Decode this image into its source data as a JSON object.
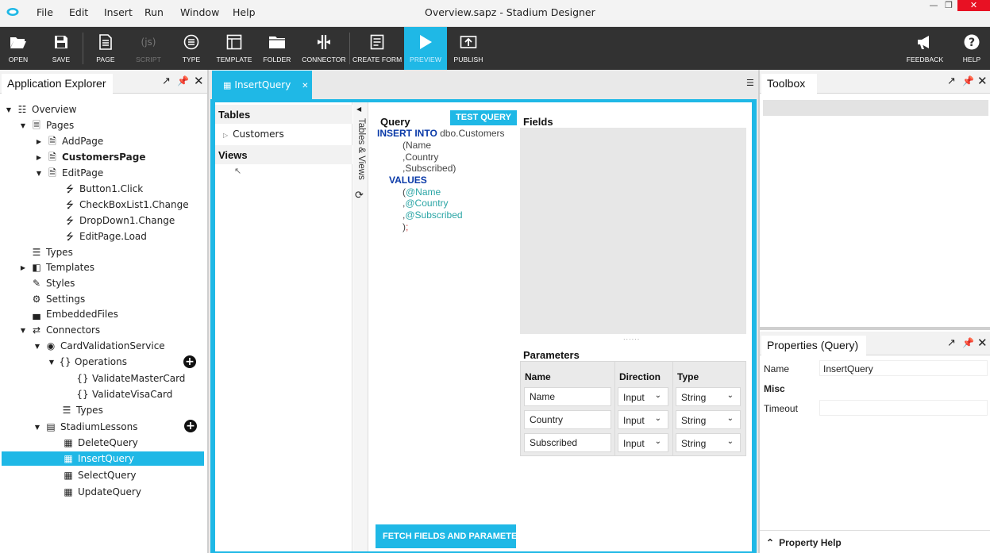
{
  "menu": [
    "File",
    "Edit",
    "Insert",
    "Run",
    "Window",
    "Help"
  ],
  "window_title": "Overview.sapz - Stadium Designer",
  "toolbar": {
    "open": "OPEN",
    "save": "SAVE",
    "page": "PAGE",
    "script": "SCRIPT",
    "type": "TYPE",
    "template": "TEMPLATE",
    "folder": "FOLDER",
    "connector": "CONNECTOR",
    "create_form": "CREATE FORM",
    "preview": "PREVIEW",
    "publish": "PUBLISH",
    "feedback": "FEEDBACK",
    "help": "HELP"
  },
  "explorer": {
    "title": "Application Explorer",
    "items": [
      {
        "label": "Overview"
      },
      {
        "label": "Pages"
      },
      {
        "label": "AddPage"
      },
      {
        "label": "CustomersPage"
      },
      {
        "label": "EditPage"
      },
      {
        "label": "Button1.Click"
      },
      {
        "label": "CheckBoxList1.Change"
      },
      {
        "label": "DropDown1.Change"
      },
      {
        "label": "EditPage.Load"
      },
      {
        "label": "Types"
      },
      {
        "label": "Templates"
      },
      {
        "label": "Styles"
      },
      {
        "label": "Settings"
      },
      {
        "label": "EmbeddedFiles"
      },
      {
        "label": "Connectors"
      },
      {
        "label": "CardValidationService"
      },
      {
        "label": "Operations"
      },
      {
        "label": "ValidateMasterCard"
      },
      {
        "label": "ValidateVisaCard"
      },
      {
        "label": "Types"
      },
      {
        "label": "StadiumLessons"
      },
      {
        "label": "DeleteQuery"
      },
      {
        "label": "InsertQuery"
      },
      {
        "label": "SelectQuery"
      },
      {
        "label": "UpdateQuery"
      }
    ]
  },
  "doc_tab": "InsertQuery",
  "db": {
    "tables_label": "Tables",
    "table_item": "Customers",
    "views_label": "Views",
    "side_label": "Tables & Views"
  },
  "query": {
    "label": "Query",
    "test_button": "TEST QUERY",
    "l1a": "INSERT INTO",
    "l1b": " dbo.Customers",
    "l2": "(Name",
    "l3": ",Country",
    "l4": ",Subscribed)",
    "l5": "VALUES",
    "l6a": "(",
    "l6b": "@Name",
    "l7a": ",",
    "l7b": "@Country",
    "l8a": ",",
    "l8b": "@Subscribed",
    "l9a": ")",
    "l9b": ";",
    "fetch_button": "FETCH FIELDS AND PARAMETERS"
  },
  "fields_label": "Fields",
  "parameters": {
    "label": "Parameters",
    "headers": [
      "Name",
      "Direction",
      "Type"
    ],
    "rows": [
      {
        "name": "Name",
        "direction": "Input",
        "type": "String"
      },
      {
        "name": "Country",
        "direction": "Input",
        "type": "String"
      },
      {
        "name": "Subscribed",
        "direction": "Input",
        "type": "String"
      }
    ]
  },
  "toolbox_title": "Toolbox",
  "properties": {
    "title": "Properties (Query)",
    "name_label": "Name",
    "name_value": "InsertQuery",
    "misc_label": "Misc",
    "timeout_label": "Timeout",
    "help_label": "Property Help"
  }
}
